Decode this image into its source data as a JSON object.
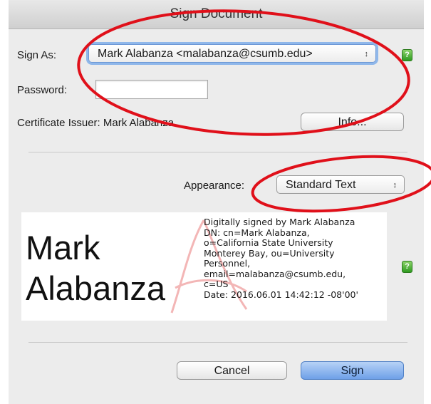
{
  "dialog": {
    "title": "Sign Document",
    "sign_as_label": "Sign As:",
    "sign_as_value": "Mark Alabanza <malabanza@csumb.edu>",
    "password_label": "Password:",
    "password_value": "",
    "certificate_issuer_label": "Certificate Issuer: Mark Alabanza",
    "info_button": "Info...",
    "appearance_label": "Appearance:",
    "appearance_value": "Standard Text",
    "signature_preview": {
      "name_line1": "Mark",
      "name_line2": "Alabanza",
      "details": [
        "Digitally signed by Mark Alabanza",
        "DN: cn=Mark Alabanza,",
        "o=California State University",
        "Monterey Bay, ou=University",
        "Personnel,",
        "email=malabanza@csumb.edu,",
        "c=US",
        "Date: 2016.06.01 14:42:12 -08'00'"
      ]
    },
    "cancel_button": "Cancel",
    "sign_button": "Sign",
    "help_glyph": "?"
  },
  "annotations": {
    "ellipse_color": "#e0101a",
    "icons": [
      "help-icon",
      "updown-arrows-icon",
      "adobe-watermark-icon"
    ]
  }
}
